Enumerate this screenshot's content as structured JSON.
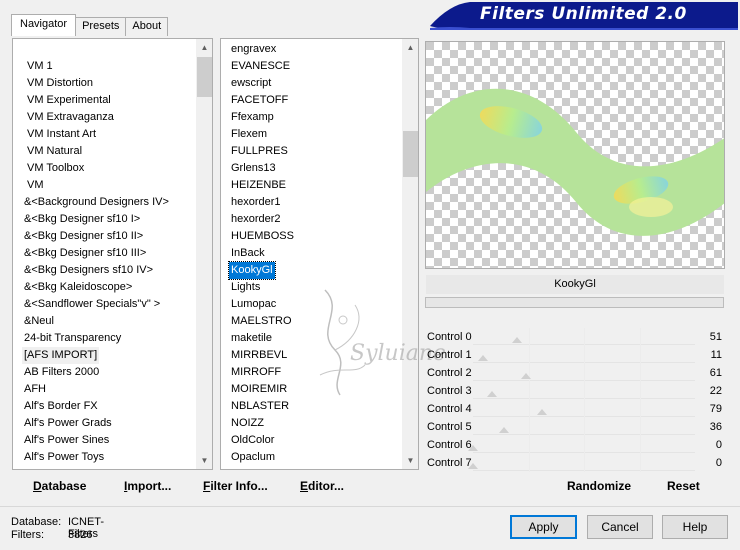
{
  "tabs": [
    "Navigator",
    "Presets",
    "About"
  ],
  "banner_title": "Filters Unlimited 2.0",
  "categories": [
    "VM 1",
    "VM Distortion",
    "VM Experimental",
    "VM Extravaganza",
    "VM Instant Art",
    "VM Natural",
    "VM Toolbox",
    "VM",
    "&<Background Designers IV>",
    "&<Bkg Designer sf10 I>",
    "&<Bkg Designer sf10 II>",
    "&<Bkg Designer sf10 III>",
    "&<Bkg Designers sf10 IV>",
    "&<Bkg Kaleidoscope>",
    "&<Sandflower Specials\"v\" >",
    "&Neul",
    "24-bit Transparency",
    "[AFS IMPORT]",
    "AB Filters 2000",
    "AFH",
    "Alf's Border FX",
    "Alf's Power Grads",
    "Alf's Power Sines",
    "Alf's Power Toys"
  ],
  "filters": [
    "engravex",
    "EVANESCE",
    "ewscript",
    "FACETOFF",
    "Ffexamp",
    "Flexem",
    "FULLPRES",
    "Grlens13",
    "HEIZENBE",
    "hexorder1",
    "hexorder2",
    "HUEMBOSS",
    "InBack",
    "KookyGl",
    "Lights",
    "Lumopac",
    "MAELSTRO",
    "maketile",
    "MIRRBEVL",
    "MIRROFF",
    "MOIREMIR",
    "NBLASTER",
    "NOIZZ",
    "OldColor",
    "Opaclum"
  ],
  "selected_filter": "KookyGl",
  "controls": [
    {
      "label": "Control 0",
      "value": 51
    },
    {
      "label": "Control 1",
      "value": 11
    },
    {
      "label": "Control 2",
      "value": 61
    },
    {
      "label": "Control 3",
      "value": 22
    },
    {
      "label": "Control 4",
      "value": 79
    },
    {
      "label": "Control 5",
      "value": 36
    },
    {
      "label": "Control 6",
      "value": 0
    },
    {
      "label": "Control 7",
      "value": 0
    }
  ],
  "left_buttons": {
    "database": {
      "u": "D",
      "rest": "atabase"
    },
    "import": {
      "u": "I",
      "rest": "mport..."
    },
    "filter_info": {
      "u": "F",
      "rest": "ilter Info..."
    },
    "editor": {
      "u": "E",
      "rest": "ditor..."
    }
  },
  "right_buttons": {
    "randomize": "Randomize",
    "reset": "Reset"
  },
  "status": {
    "database_label": "Database:",
    "database_value": "ICNET-Filters",
    "filters_label": "Filters:",
    "filters_value": "3826"
  },
  "bottom_buttons": {
    "apply": "Apply",
    "cancel": "Cancel",
    "help": "Help"
  },
  "watermark": "Syluiane",
  "colors": {
    "banner": "#0c1a8c",
    "selection": "#0078d7",
    "ribbon": "#b6e39a"
  }
}
